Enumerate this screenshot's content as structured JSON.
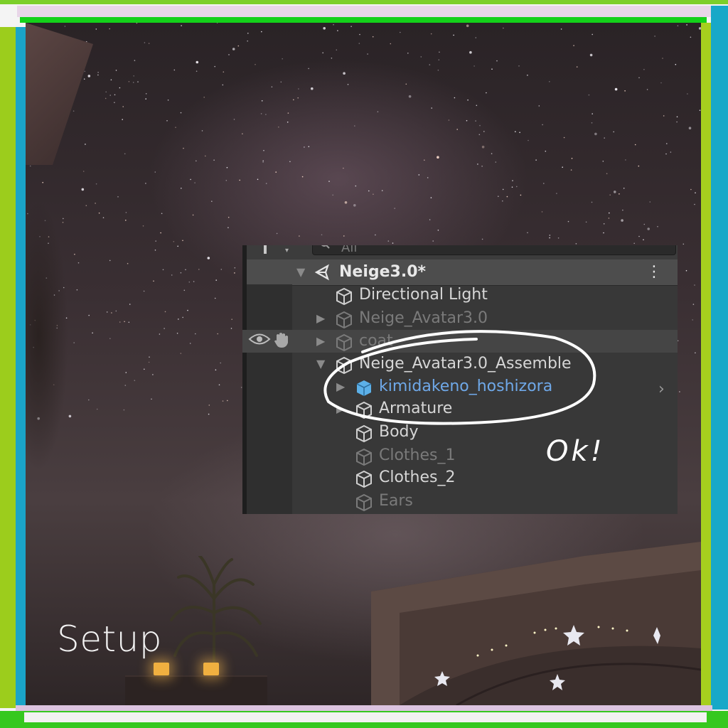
{
  "hierarchy": {
    "search_placeholder": "All",
    "scene_name": "Neige3.0*",
    "items": [
      {
        "label": "Directional Light",
        "state": "normal"
      },
      {
        "label": "Neige_Avatar3.0",
        "state": "disabled"
      },
      {
        "label": "coat",
        "state": "disabled"
      },
      {
        "label": "Neige_Avatar3.0_Assemble",
        "state": "normal"
      },
      {
        "label": "kimidakeno_hoshizora",
        "state": "prefab"
      },
      {
        "label": "Armature",
        "state": "normal"
      },
      {
        "label": "Body",
        "state": "normal"
      },
      {
        "label": "Clothes_1",
        "state": "disabled"
      },
      {
        "label": "Clothes_2",
        "state": "normal"
      },
      {
        "label": "Ears",
        "state": "disabled"
      }
    ]
  },
  "annotation": {
    "handwritten_note": "Ok!",
    "stroke_color": "#ffffff"
  },
  "caption": "Setup",
  "colors": {
    "prefab_blue": "#6fa8e8",
    "panel_bg": "#383838",
    "frame_green": "#14d11a",
    "frame_blue": "#1aa4c8"
  }
}
